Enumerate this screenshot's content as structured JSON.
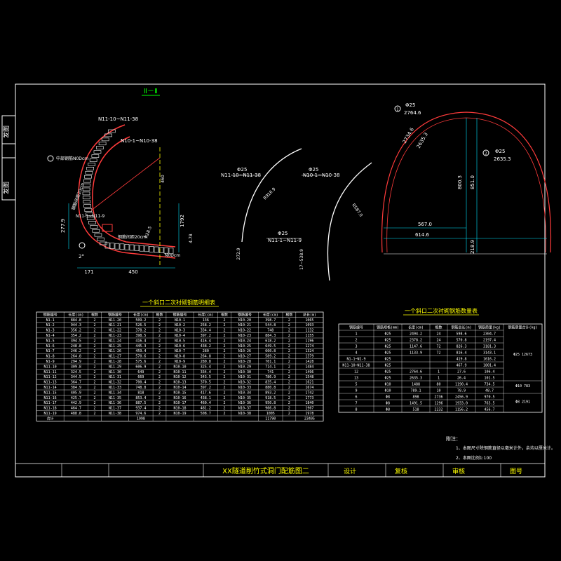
{
  "colors": {
    "background": "#000000",
    "frame": "#ffffff",
    "rebar": "#ff3b3b",
    "dim": "#00e5ff",
    "text_green": "#00ff00",
    "text_yellow": "#ffff00",
    "text_white": "#ffffff",
    "hatch": "#ffffff"
  },
  "side_labels": [
    "发图",
    "发图"
  ],
  "section_title": "Ⅱ－Ⅱ",
  "left_drawing": {
    "labels": [
      "N11-10~N11-38",
      "N10-1~N10-38",
      "中部钢筋N0Dcm",
      "钢筋间距20cm",
      "N11-1~N11-9",
      "钢筋间距20cm",
      "N0Dcm"
    ],
    "dims": [
      "277.9",
      "171",
      "450",
      "460",
      "2°",
      "1792",
      "R28.5",
      "4.78"
    ]
  },
  "middle_drawing": {
    "labels": [
      "Φ25",
      "N11-10~N11-38",
      "Φ25",
      "N10-1~N10-38",
      "Φ25",
      "N11-1~N11-9"
    ],
    "dims": [
      "R916.9",
      "R587.0",
      "272.9",
      "17~538.9"
    ]
  },
  "right_drawing": {
    "labels": [
      "Φ25",
      "2764.6",
      "Φ25",
      "2635.3"
    ],
    "dims": [
      "2734.6",
      "2635.3",
      "800.3",
      "851.0",
      "567.0",
      "614.6",
      "218.9"
    ],
    "callouts": [
      "1",
      "2"
    ]
  },
  "table1": {
    "title": "一个斜口二次衬砌钢筋明细表",
    "headers": [
      "钢筋编号",
      "长度(cm)",
      "根数",
      "钢筋编号",
      "长度(cm)",
      "根数",
      "钢筋编号",
      "长度(cm)",
      "根数",
      "钢筋编号",
      "长度(cm)",
      "根数",
      "总长(m)"
    ],
    "rows": [
      [
        "N1-1",
        "884.8",
        "2",
        "N11-20",
        "509.2",
        "2",
        "N10-1",
        "136",
        "2",
        "N10-20",
        "398.7",
        "2",
        "1065"
      ],
      [
        "N1-2",
        "944.3",
        "2",
        "N11-21",
        "526.5",
        "2",
        "N10-2",
        "258.2",
        "2",
        "N10-21",
        "544.8",
        "2",
        "1093"
      ],
      [
        "N1-3",
        "356.2",
        "2",
        "N11-22",
        "378.2",
        "2",
        "N10-3",
        "334.4",
        "2",
        "N10-22",
        "748",
        "2",
        "1132"
      ],
      [
        "N1-4",
        "354.2",
        "2",
        "N11-23",
        "398.5",
        "2",
        "N10-4",
        "397.2",
        "2",
        "N10-23",
        "884.3",
        "2",
        "1155"
      ],
      [
        "N1-5",
        "394.5",
        "2",
        "N11-24",
        "416.4",
        "2",
        "N10-5",
        "416.4",
        "2",
        "N10-24",
        "618.2",
        "2",
        "1196"
      ],
      [
        "N1-6",
        "248.8",
        "2",
        "N11-25",
        "445.3",
        "2",
        "N10-6",
        "438.2",
        "2",
        "N10-25",
        "649.5",
        "2",
        "1274"
      ],
      [
        "N1-7",
        "246.2",
        "2",
        "N11-26",
        "459.4",
        "2",
        "N10-7",
        "280",
        "2",
        "N10-26",
        "660.8",
        "2",
        "1324"
      ],
      [
        "N1-8",
        "264.8",
        "2",
        "N11-27",
        "570.6",
        "2",
        "N10-8",
        "264.8",
        "2",
        "N10-27",
        "589.2",
        "2",
        "1379"
      ],
      [
        "N1-9",
        "294.9",
        "2",
        "N11-28",
        "575.6",
        "2",
        "N10-9",
        "280.8",
        "2",
        "N10-28",
        "701.1",
        "2",
        "1428"
      ],
      [
        "N11-10",
        "309.8",
        "2",
        "N11-29",
        "606.9",
        "2",
        "N10-10",
        "325.4",
        "2",
        "N10-29",
        "714.1",
        "2",
        "1484"
      ],
      [
        "N11-11",
        "324.5",
        "2",
        "N11-30",
        "649",
        "2",
        "N10-11",
        "334.4",
        "2",
        "N10-30",
        "741",
        "2",
        "1496"
      ],
      [
        "N11-12",
        "344.5",
        "2",
        "N11-31",
        "669",
        "2",
        "N10-12",
        "343.5",
        "2",
        "N10-31",
        "786.9",
        "2",
        "1548"
      ],
      [
        "N11-13",
        "364.7",
        "2",
        "N11-32",
        "700.4",
        "2",
        "N10-13",
        "370.5",
        "2",
        "N10-32",
        "835.4",
        "2",
        "1621"
      ],
      [
        "N11-14",
        "384.9",
        "2",
        "N11-33",
        "748.8",
        "2",
        "N10-14",
        "397.2",
        "2",
        "N10-33",
        "880.8",
        "2",
        "1674"
      ],
      [
        "N11-15",
        "405.9",
        "2",
        "N11-34",
        "818",
        "2",
        "N10-15",
        "417.6",
        "2",
        "N10-34",
        "893.2",
        "2",
        "1742"
      ],
      [
        "N11-16",
        "425.7",
        "2",
        "N11-35",
        "853.4",
        "2",
        "N10-16",
        "438.1",
        "2",
        "N10-35",
        "918.5",
        "2",
        "1773"
      ],
      [
        "N11-17",
        "442.9",
        "2",
        "N11-36",
        "887.5",
        "2",
        "N10-17",
        "460.4",
        "2",
        "N10-36",
        "950.8",
        "2",
        "1840"
      ],
      [
        "N11-18",
        "464.7",
        "2",
        "N11-37",
        "937.4",
        "2",
        "N10-18",
        "481.2",
        "2",
        "N10-37",
        "966.8",
        "2",
        "1907"
      ],
      [
        "N11-19",
        "488.8",
        "2",
        "N11-38",
        "974.6",
        "2",
        "N10-19",
        "508.7",
        "2",
        "N10-38",
        "1005",
        "2",
        "1978"
      ]
    ],
    "total_row": [
      "合计",
      "",
      "",
      "",
      "1998",
      "",
      "",
      "",
      "",
      "",
      "11790",
      "",
      "23405"
    ]
  },
  "table2": {
    "title": "一个斜口二次衬砌钢筋数量表",
    "headers": [
      "钢筋编号",
      "钢筋规格(mm)",
      "长度(cm)",
      "根数",
      "钢筋总长(m)",
      "钢筋质量(kg)",
      "钢筋质量合计(kg)"
    ],
    "rows": [
      [
        "1",
        "Φ25",
        "2494.2",
        "24",
        "598.6",
        "2304.7"
      ],
      [
        "2",
        "Φ25",
        "2378.2",
        "24",
        "570.8",
        "2197.4"
      ],
      [
        "3",
        "Φ25",
        "1147.6",
        "72",
        "826.3",
        "3181.3"
      ],
      [
        "4",
        "Φ25",
        "1133.9",
        "72",
        "816.4",
        "3143.1"
      ],
      [
        "N1-1~N1-9",
        "Φ25",
        "",
        "",
        "419.8",
        "1616.2"
      ],
      [
        "N11-10~N11-38",
        "Φ25",
        "",
        "",
        "467.9",
        "1801.4"
      ],
      [
        "12",
        "Φ25",
        "2764.6",
        "1",
        "27.6",
        "106.4"
      ],
      [
        "13",
        "Φ25",
        "2635.3",
        "1",
        "26.4",
        "101.5"
      ],
      [
        "5",
        "Φ10",
        "1488",
        "80",
        "1190.4",
        "734.5"
      ],
      [
        "9",
        "Φ10",
        "789.1",
        "10",
        "78.9",
        "48.7"
      ],
      [
        "6",
        "Φ8",
        "898",
        "2736",
        "2456.9",
        "970.5"
      ],
      [
        "7",
        "Φ8",
        "1491.5",
        "1296",
        "1933.0",
        "763.5"
      ],
      [
        "8",
        "Φ8",
        "518",
        "2232",
        "1156.2",
        "456.7"
      ]
    ],
    "subtotals": [
      "Φ25 12673",
      "Φ10 783",
      "Φ8 2191"
    ]
  },
  "notes": {
    "title": "附注：",
    "lines": [
      "1、本图尺寸除钢筋直径以毫米计外，余均以厘米计。",
      "2、本图比例1:100"
    ]
  },
  "title_block": {
    "project_title": "XX隧道削竹式洞门配筋图二",
    "design_label": "设计",
    "review_label": "复核",
    "approve_label": "审核",
    "drawing_no_label": "图号"
  }
}
